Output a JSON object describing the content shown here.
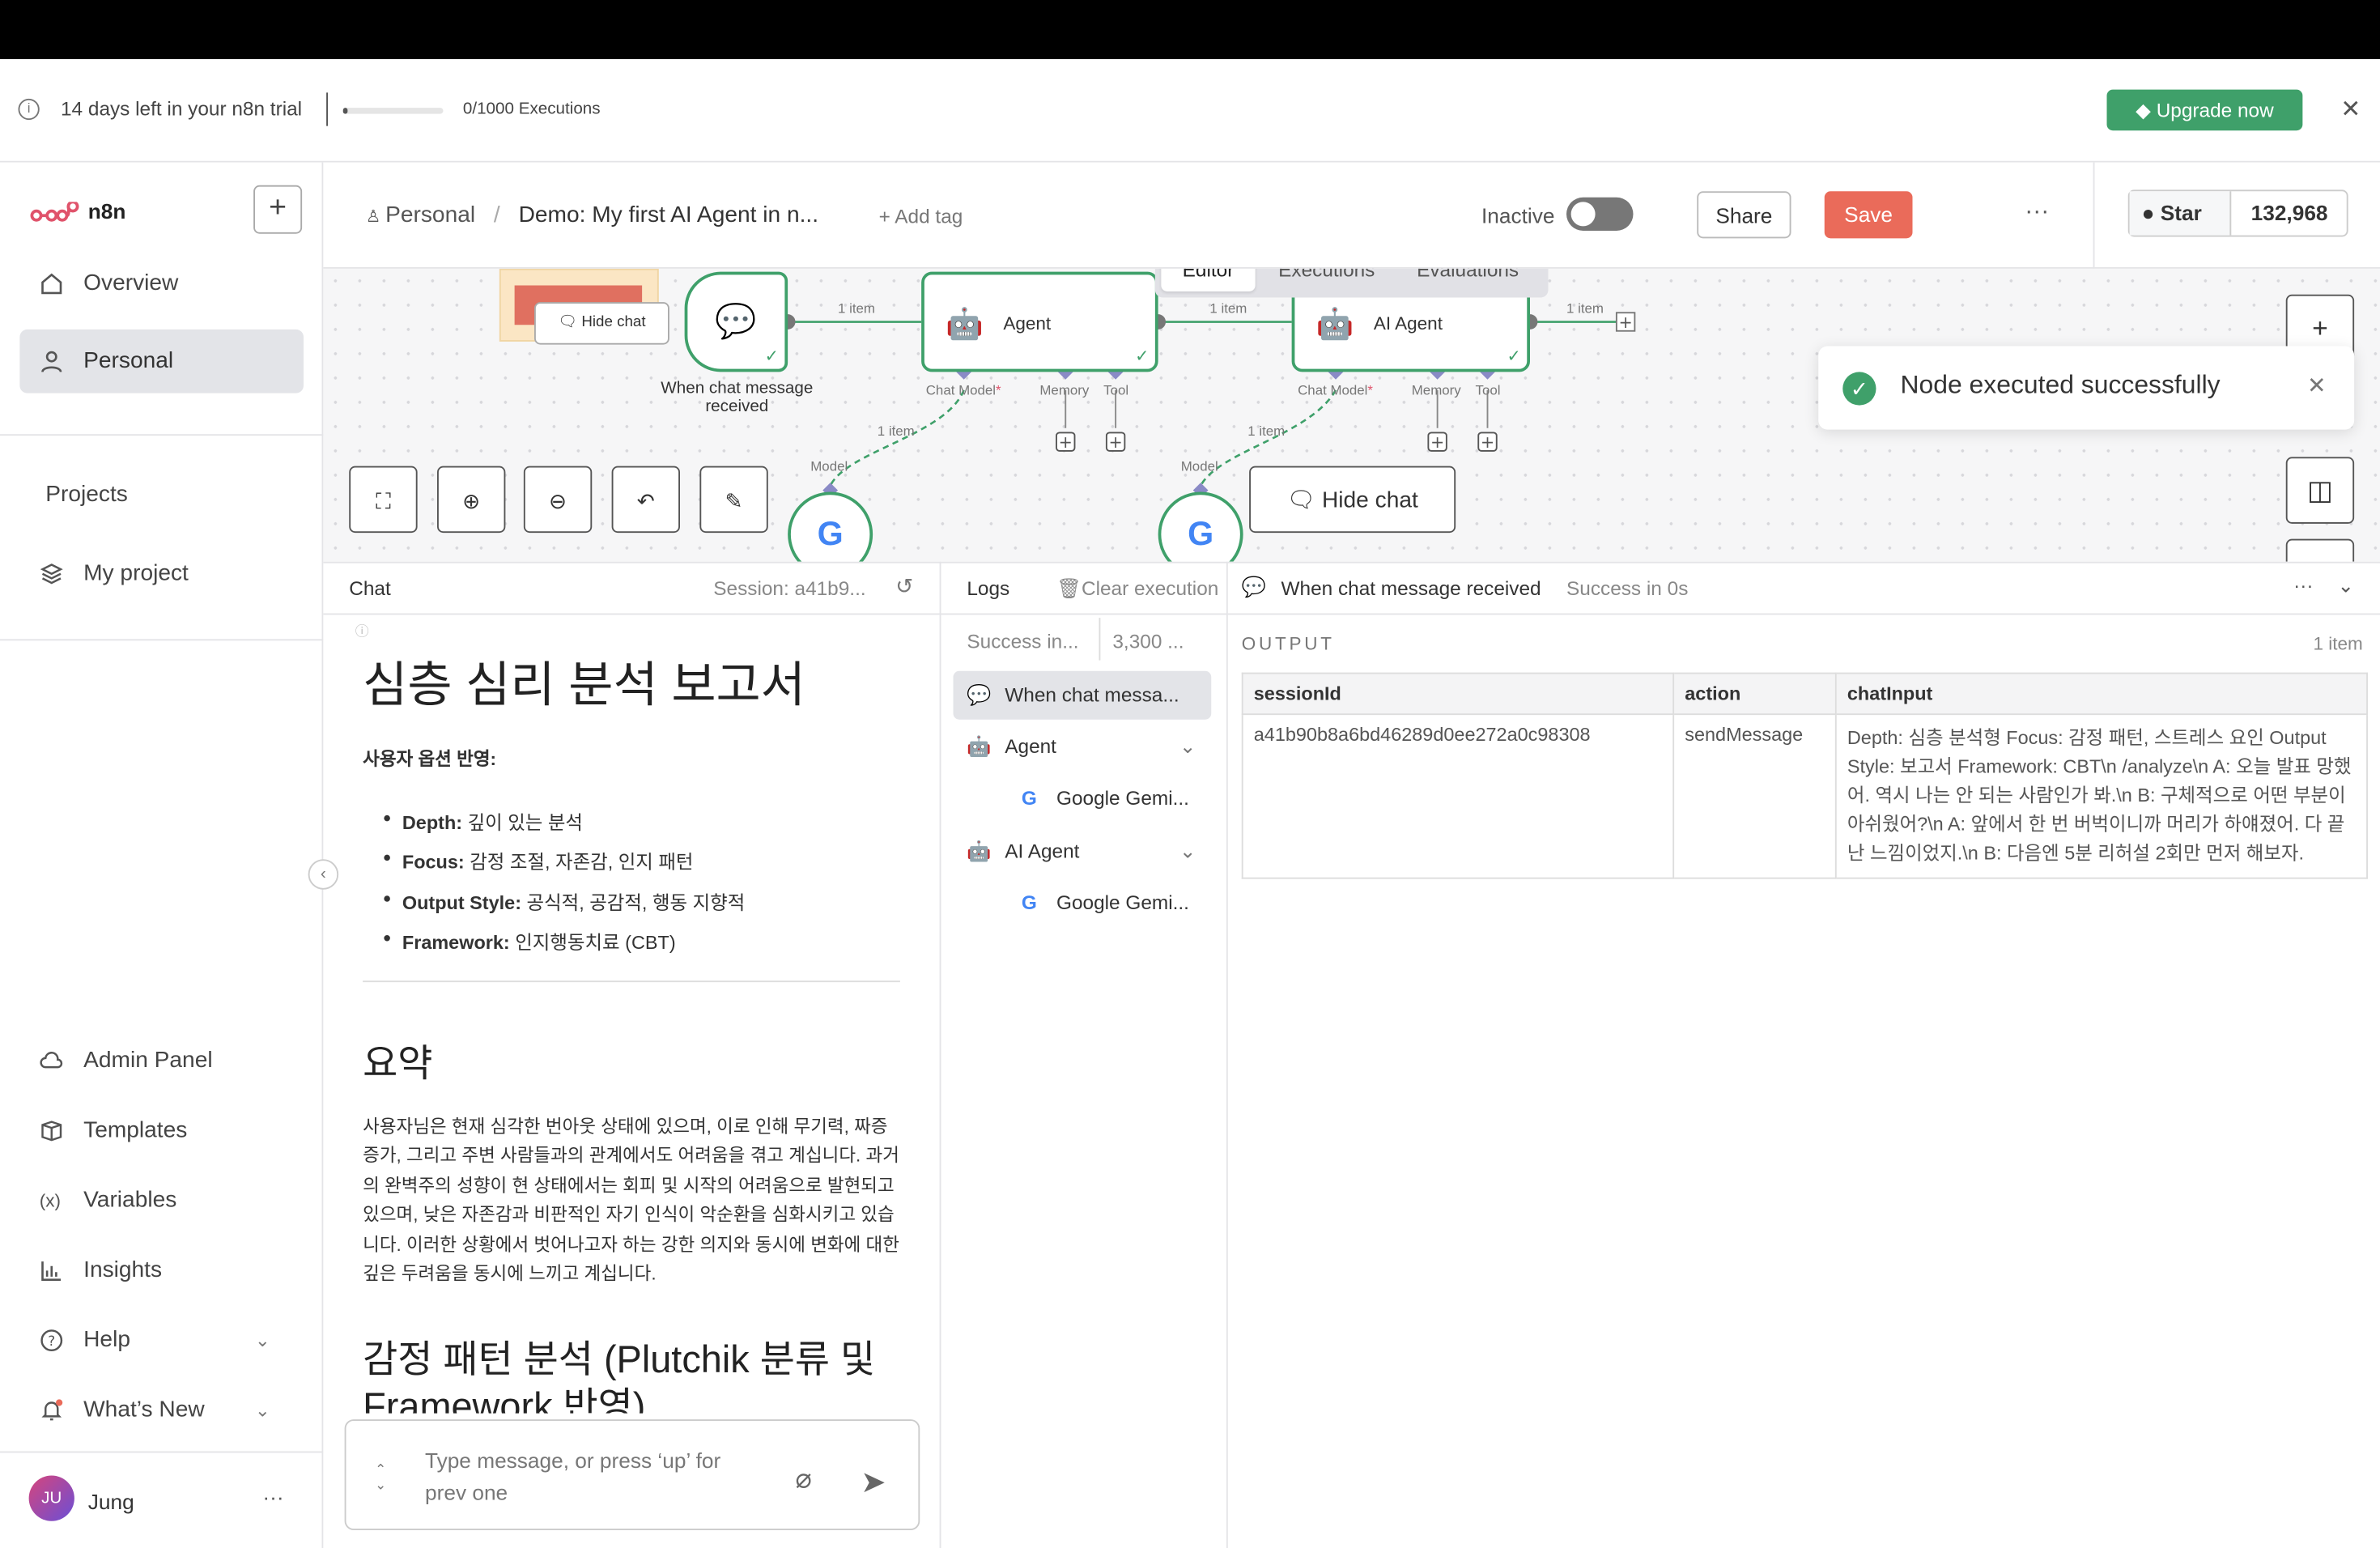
{
  "trial": {
    "text": "14 days left in your n8n trial",
    "executions": "0/1000 Executions",
    "upgrade": "Upgrade now",
    "progress": 0.0
  },
  "sidebar": {
    "brand": "n8n",
    "items": [
      {
        "label": "Overview",
        "icon": "home-icon"
      },
      {
        "label": "Personal",
        "icon": "user-icon"
      }
    ],
    "projects_label": "Projects",
    "project": "My project",
    "bottom": [
      {
        "label": "Admin Panel",
        "icon": "cloud-icon"
      },
      {
        "label": "Templates",
        "icon": "box-icon"
      },
      {
        "label": "Variables",
        "icon": "variable-icon"
      },
      {
        "label": "Insights",
        "icon": "chart-icon"
      },
      {
        "label": "Help",
        "icon": "help-icon"
      },
      {
        "label": "What’s New",
        "icon": "bell-icon"
      }
    ],
    "user": {
      "initials": "JU",
      "name": "Jung"
    }
  },
  "header": {
    "crumb_root": "Personal",
    "crumb_sep": "/",
    "title": "Demo: My first AI Agent in n...",
    "add_tag": "+ Add tag",
    "status": "Inactive",
    "share": "Share",
    "save": "Save",
    "star": "Star",
    "star_count": "132,968"
  },
  "canvas": {
    "tabs": [
      "Editor",
      "Executions",
      "Evaluations"
    ],
    "nodes": {
      "trigger": "When chat message received",
      "agent1": "Agent",
      "agent2": "AI Agent"
    },
    "edge_items": "1 item",
    "ports": {
      "chat_model": "Chat Model",
      "required": "*",
      "memory": "Memory",
      "tool": "Tool",
      "model": "Model"
    },
    "hide_chat": "Hide chat",
    "toast": "Node executed successfully"
  },
  "chat": {
    "title": "Chat",
    "session": "Session: a41b9...",
    "heading": "심층 심리 분석 보고서",
    "options_label": "사용자 옵션 반영:",
    "bullets": [
      {
        "k": "Depth:",
        "v": " 깊이 있는 분석"
      },
      {
        "k": "Focus:",
        "v": " 감정 조절, 자존감, 인지 패턴"
      },
      {
        "k": "Output Style:",
        "v": " 공식적, 공감적, 행동 지향적"
      },
      {
        "k": "Framework:",
        "v": " 인지행동치료 (CBT)"
      }
    ],
    "summary_h": "요약",
    "summary": "사용자님은 현재 심각한 번아웃 상태에 있으며, 이로 인해 무기력, 짜증 증가, 그리고 주변 사람들과의 관계에서도 어려움을 겪고 계십니다. 과거의 완벽주의 성향이 현 상태에서는 회피 및 시작의 어려움으로 발현되고 있으며, 낮은 자존감과 비판적인 자기 인식이 악순환을 심화시키고 있습니다. 이러한 상황에서 벗어나고자 하는 강한 의지와 동시에 변화에 대한 깊은 두려움을 동시에 느끼고 계십니다.",
    "emotion_h": "감정 패턴 분석 (Plutchik 분류 및 Framework 반영)",
    "placeholder": "Type message, or press ‘up’ for prev one"
  },
  "logs": {
    "title": "Logs",
    "clear": "Clear execution",
    "status": "Success in...",
    "tokens": "3,300 ...",
    "rows": [
      "When chat messa...",
      "Agent",
      "Google Gemi...",
      "AI Agent",
      "Google Gemi..."
    ]
  },
  "output": {
    "node": "When chat message received",
    "status": "Success in 0s",
    "label": "OUTPUT",
    "count": "1 item",
    "columns": [
      "sessionId",
      "action",
      "chatInput"
    ],
    "row": [
      "a41b90b8a6bd46289d0ee272a0c98308",
      "sendMessage",
      "Depth: 심층 분석형 Focus: 감정 패턴, 스트레스 요인 Output Style: 보고서 Framework: CBT\\n /analyze\\n A: 오늘 발표 망했어. 역시 나는 안 되는 사람인가 봐.\\n B: 구체적으로 어떤 부분이 아쉬웠어?\\n A: 앞에서 한 번 버벅이니까 머리가 하얘졌어. 다 끝난 느낌이었지.\\n B: 다음엔 5분 리허설 2회만 먼저 해보자."
    ]
  },
  "colors": {
    "green": "#3fa06a",
    "save": "#ea6b5a"
  }
}
